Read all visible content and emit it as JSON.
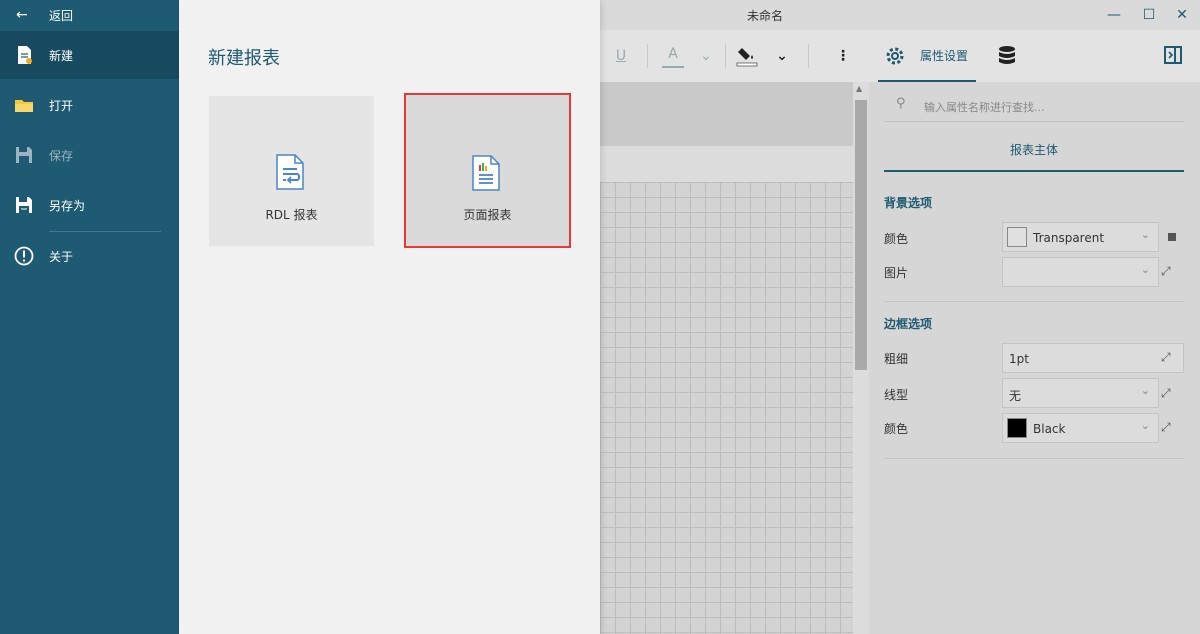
{
  "window": {
    "title": "未命名",
    "controls": [
      "minimize-icon",
      "maximize-icon",
      "close-icon"
    ]
  },
  "toolbar": {
    "underline_label": "U",
    "font_color_label": "A",
    "props_tab_label": "属性设置"
  },
  "properties": {
    "search_placeholder": "输入属性名称进行查找...",
    "section_tab": "报表主体",
    "background_group": {
      "title": "背景选项",
      "color_label": "颜色",
      "color_value": "Transparent",
      "image_label": "图片",
      "image_value": ""
    },
    "border_group": {
      "title": "边框选项",
      "width_label": "粗细",
      "width_value": "1pt",
      "style_label": "线型",
      "style_value": "无",
      "color_label": "颜色",
      "color_value": "Black"
    }
  },
  "sidebar": {
    "back_label": "返回",
    "items": [
      {
        "label": "新建",
        "icon": "new-file-icon",
        "active": true
      },
      {
        "label": "打开",
        "icon": "folder-icon"
      },
      {
        "label": "保存",
        "icon": "save-icon",
        "disabled": true
      },
      {
        "label": "另存为",
        "icon": "save-as-icon"
      },
      {
        "label": "关于",
        "icon": "info-icon"
      }
    ]
  },
  "new_report": {
    "title": "新建报表",
    "cards": [
      {
        "label": "RDL 报表",
        "icon": "rdl-report-icon"
      },
      {
        "label": "页面报表",
        "icon": "page-report-icon",
        "selected": true
      }
    ]
  },
  "colors": {
    "accent": "#1e5a72",
    "sidebar_bg": "#1e5a72",
    "selection_border": "#e53935",
    "panel_bg": "#f1f1f1"
  }
}
